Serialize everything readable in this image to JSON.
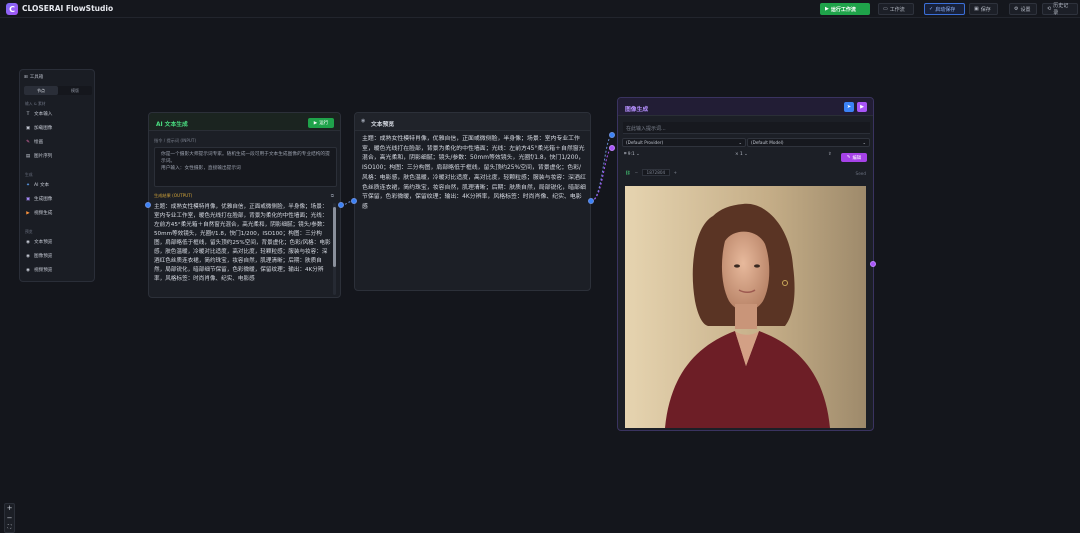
{
  "app": {
    "logo_letter": "C",
    "title": "CLOSERAI FlowStudio"
  },
  "toolbar": {
    "run_label": "运行工作流",
    "workflow_label": "工作流",
    "autosave_label": "启动保存",
    "save_label": "保存",
    "settings_label": "设置",
    "history_label": "历史记录"
  },
  "toolbox": {
    "title": "工具箱",
    "tabs": [
      "节点",
      "模版"
    ],
    "sections": [
      {
        "label": "输入 & 素材",
        "items": [
          "文本输入",
          "加载图像",
          "绘画",
          "图片序列"
        ]
      },
      {
        "label": "生成",
        "items": [
          "AI 文本",
          "生成图像",
          "视频生成"
        ]
      },
      {
        "label": "预览",
        "items": [
          "文本预览",
          "图像预览",
          "视频预览"
        ]
      }
    ]
  },
  "ai_node": {
    "title": "AI 文本生成",
    "run_label": "运行",
    "input_label": "指令 / 提示词 (INPUT)",
    "input_text": "你是一个摄影大师提示词专家。随机生成一段可用于文本生成图像的专业结构的提示词。\n用户输入：女性摄影，直接输出提示词",
    "output_label": "生成结果 (OUTPUT)",
    "output_text": "主题：成熟女性模特肖像，优雅自信，正面或微侧脸，半身像；场景：室内专业工作室，暖色光线打在脸部，背景为柔化的中性墙面；光线：左前方45°柔光箱＋自然窗光混合，高光柔和，阴影细腻；镜头/参数：50mm等效镜头，光圈f/1.8，快门1/200，ISO100；构图：三分构图，肩部略低于框线，留头顶约25%空间，背景虚化；色彩/风格：电影感，肤色温暖，冷暖对比适度，高对比度，轻颗粒感；服装与妆容：深酒红色丝质连衣裙，简约珠宝，妆容自然，肌理清晰；后期：肤质自然，局部锐化，暗部细节保留，色彩微暖，保留纹理；输出：4K分辨率，风格标签：时尚肖像、纪实、电影感"
  },
  "preview_node": {
    "title": "文本预览",
    "text": "主题：成熟女性模特肖像，优雅自信，正面或微侧脸，半身像；场景：室内专业工作室，暖色光线打在脸部，背景为柔化的中性墙面；光线：左前方45°柔光箱＋自然窗光混合，高光柔和，阴影细腻；镜头/参数：50mm等效镜头，光圈f/1.8，快门1/200，ISO100；构图：三分构图，肩部略低于框线，留头顶约25%空间，背景虚化；色彩/风格：电影感，肤色温暖，冷暖对比适度，高对比度，轻颗粒感；服装与妆容：深酒红色丝质连衣裙，简约珠宝，妆容自然，肌理清晰；后期：肤质自然，局部锐化，暗部细节保留，色彩微暖，保留纹理；输出：4K分辨率，风格标签：时尚肖像、纪实、电影感"
  },
  "image_node": {
    "title": "图像生成",
    "prompt_placeholder": "在此输入提示词...",
    "provider": "(Default Provider)",
    "model": "(Default Model)",
    "ratio": "9:1",
    "count": "× 1",
    "edit_label": "编辑",
    "seed_value": "1872804",
    "seed_label": "Seed"
  }
}
